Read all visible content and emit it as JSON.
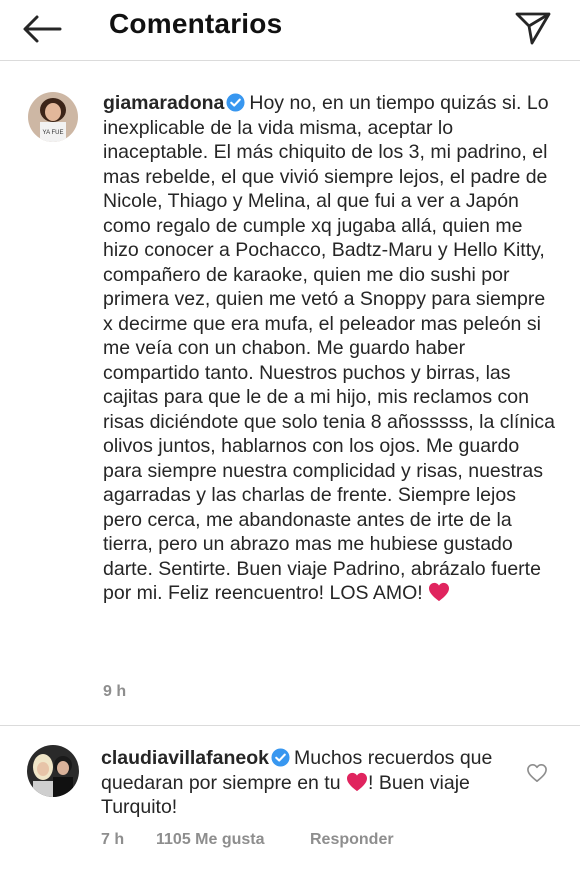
{
  "header": {
    "title": "Comentarios"
  },
  "comments": [
    {
      "username": "giamaradona",
      "text": "Hoy no, en un tiempo quizás si. Lo inexplicable de la vida misma, aceptar lo inaceptable. El más chiquito de los 3, mi padrino, el mas rebelde, el que vivió siempre lejos, el padre de Nicole, Thiago y Melina, al que fui a ver a Japón como regalo de cumple xq jugaba allá, quien me hizo conocer a Pochacco, Badtz-Maru y Hello Kitty, compañero de karaoke, quien me dio sushi por primera vez, quien me vetó a Snoppy para siempre x decirme que era mufa, el peleador mas peleón si me veía con un chabon. Me guardo haber compartido tanto. Nuestros puchos y birras, las cajitas para que le de a mi hijo, mis reclamos con risas diciéndote que solo tenia 8 añosssss, la clínica olivos juntos, hablarnos con los ojos. Me guardo para siempre nuestra complicidad y risas, nuestras agarradas y las charlas de frente. Siempre lejos pero cerca, me abandonaste antes de irte de la tierra, pero un abrazo mas me hubiese gustado darte. Sentirte. Buen viaje Padrino, abrázalo fuerte por mi. Feliz reencuentro! LOS AMO!",
      "time": "9 h"
    },
    {
      "username": "claudiavillafaneok",
      "text_part1": "Muchos recuerdos que quedaran por siempre en tu",
      "text_part2": "! Buen viaje Turquito!",
      "time": "7 h",
      "likes": "1105 Me gusta",
      "reply_label": "Responder"
    }
  ],
  "colors": {
    "verified": "#3897f0",
    "heart": "#e0245e",
    "meta": "#8e8e8e"
  },
  "icons": [
    "back-arrow-icon",
    "direct-send-icon",
    "verified-badge-icon",
    "red-heart-emoji",
    "like-heart-icon"
  ]
}
